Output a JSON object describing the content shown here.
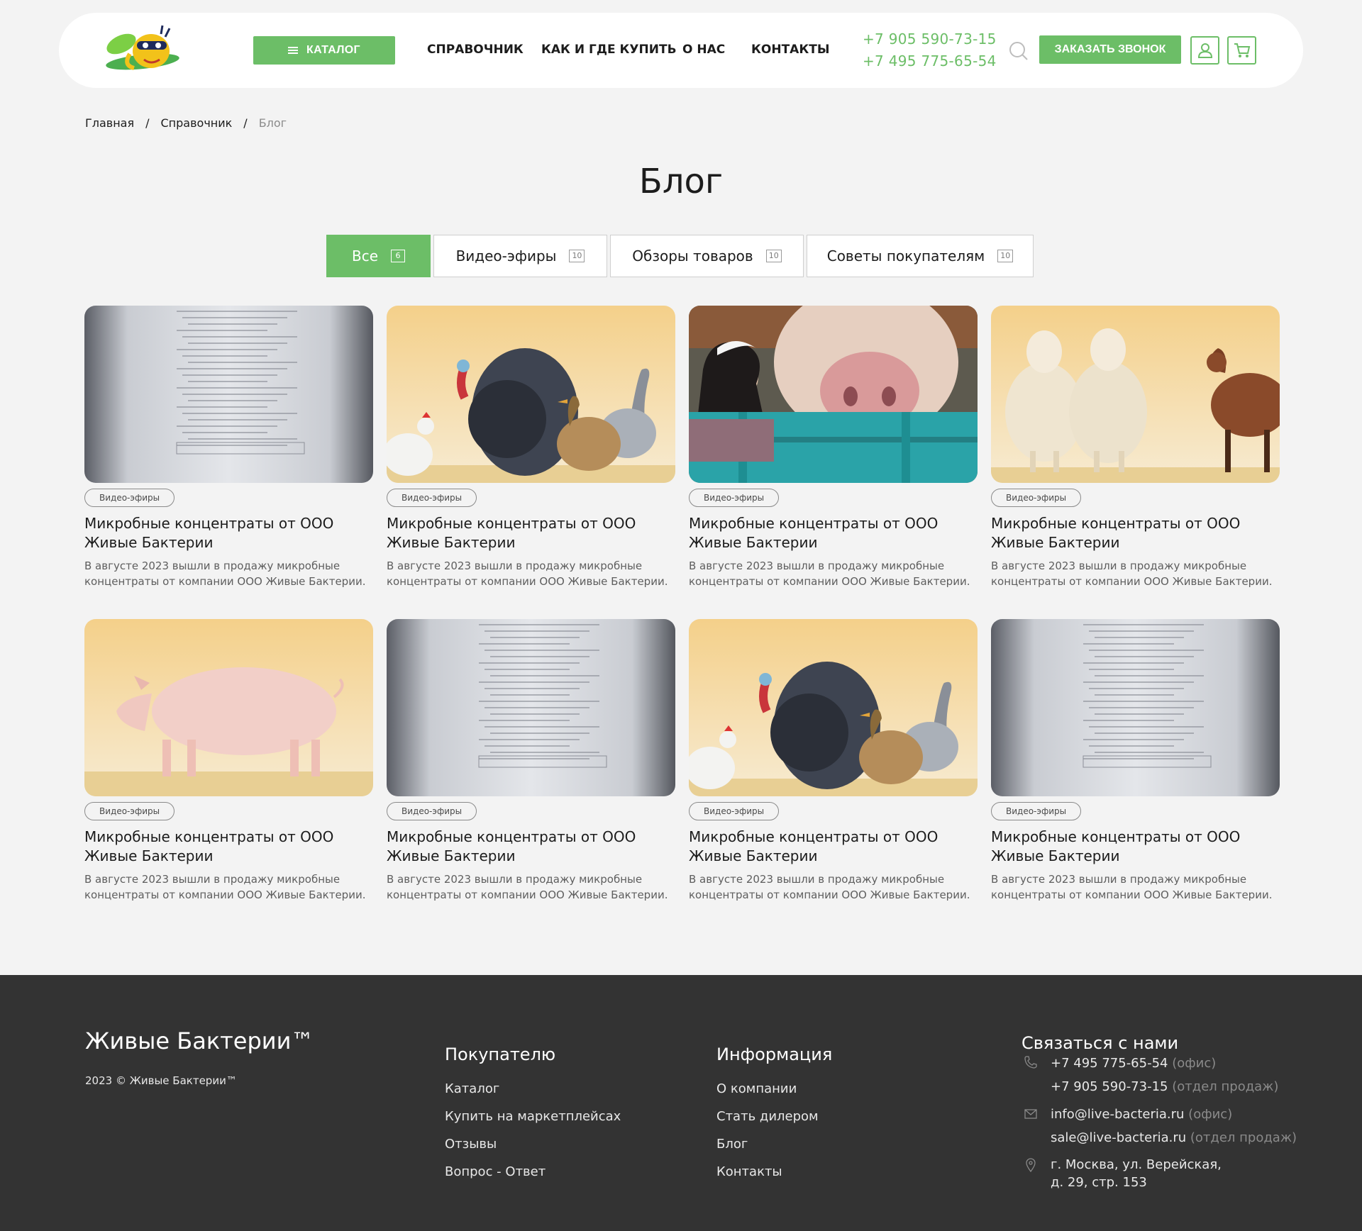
{
  "header": {
    "catalog_label": "КАТАЛОГ",
    "nav": [
      "СПРАВОЧНИК",
      "КАК И ГДЕ КУПИТЬ",
      "О НАС",
      "КОНТАКТЫ"
    ],
    "phones": [
      "+7 905 590-73-15",
      "+7 495 775-65-54"
    ],
    "call_label": "ЗАКАЗАТЬ ЗВОНОК",
    "accent": "#6cbe67"
  },
  "breadcrumb": {
    "home": "Главная",
    "section": "Справочник",
    "current": "Блог",
    "separator": "/"
  },
  "page_title": "Блог",
  "tabs": [
    {
      "label": "Все",
      "count": "6"
    },
    {
      "label": "Видео-эфиры",
      "count": "10"
    },
    {
      "label": "Обзоры товаров",
      "count": "10"
    },
    {
      "label": "Советы покупателям",
      "count": "10"
    }
  ],
  "cards": [
    {
      "image": "product-package",
      "tag": "Видео-эфиры",
      "title": "Микробные концентраты от ООО Живые Бактерии",
      "desc": "В августе 2023 вышли в продажу микробные концентраты от компании ООО Живые Бактерии."
    },
    {
      "image": "poultry",
      "tag": "Видео-эфиры",
      "title": "Микробные концентраты от ООО Живые Бактерии",
      "desc": "В августе 2023 вышли в продажу микробные концентраты от компании ООО Живые Бактерии."
    },
    {
      "image": "cow-and-woman",
      "tag": "Видео-эфиры",
      "title": "Микробные концентраты от ООО Живые Бактерии",
      "desc": "В августе 2023 вышли в продажу микробные концентраты от компании ООО Живые Бактерии."
    },
    {
      "image": "sheep-and-goat",
      "tag": "Видео-эфиры",
      "title": "Микробные концентраты от ООО Живые Бактерии",
      "desc": "В августе 2023 вышли в продажу микробные концентраты от компании ООО Живые Бактерии."
    },
    {
      "image": "pig",
      "tag": "Видео-эфиры",
      "title": "Микробные концентраты от ООО Живые Бактерии",
      "desc": "В августе 2023 вышли в продажу микробные концентраты от компании ООО Живые Бактерии."
    },
    {
      "image": "product-package",
      "tag": "Видео-эфиры",
      "title": "Микробные концентраты от ООО Живые Бактерии",
      "desc": "В августе 2023 вышли в продажу микробные концентраты от компании ООО Живые Бактерии."
    },
    {
      "image": "poultry",
      "tag": "Видео-эфиры",
      "title": "Микробные концентраты от ООО Живые Бактерии",
      "desc": "В августе 2023 вышли в продажу микробные концентраты от компании ООО Живые Бактерии."
    },
    {
      "image": "product-package",
      "tag": "Видео-эфиры",
      "title": "Микробные концентраты от ООО Живые Бактерии",
      "desc": "В августе 2023 вышли в продажу микробные концентраты от компании ООО Живые Бактерии."
    }
  ],
  "footer": {
    "brand": "Живые Бактерии™",
    "copyright": "2023 © Живые Бактерии™",
    "buyer": {
      "title": "Покупателю",
      "links": [
        "Каталог",
        "Купить на маркетплейсах",
        "Отзывы",
        "Вопрос - Ответ"
      ]
    },
    "info": {
      "title": "Информация",
      "links": [
        "О компании",
        "Стать дилером",
        "Блог",
        "Контакты"
      ]
    },
    "contact": {
      "title": "Связаться с нами",
      "phone1": "+7 495 775-65-54",
      "phone1_note": "(офис)",
      "phone2": "+7 905 590-73-15",
      "phone2_note": "(отдел продаж)",
      "email1": "info@live-bacteria.ru",
      "email1_note": "(офис)",
      "email2": "sale@live-bacteria.ru",
      "email2_note": "(отдел продаж)",
      "address_line1": "г. Москва, ул. Верейская,",
      "address_line2": "д. 29, стр. 153"
    }
  }
}
